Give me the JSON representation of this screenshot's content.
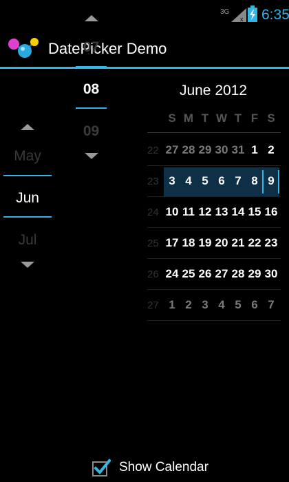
{
  "status_bar": {
    "network": "3G",
    "time": "6:35"
  },
  "action_bar": {
    "title": "DatePicker Demo",
    "logo_icon": "molecule-logo-icon",
    "accent_color": "#33b5e5"
  },
  "spinners": {
    "month": {
      "prev": "May",
      "current": "Jun",
      "next": "Jul"
    },
    "day": {
      "prev": "07",
      "current": "08",
      "next": "09"
    }
  },
  "calendar": {
    "title": "June 2012",
    "weekdays": [
      "S",
      "M",
      "T",
      "W",
      "T",
      "F",
      "S"
    ],
    "selected_date": "8",
    "weeks": [
      {
        "number": "22",
        "days": [
          "27",
          "28",
          "29",
          "30",
          "31",
          "1",
          "2"
        ]
      },
      {
        "number": "23",
        "days": [
          "3",
          "4",
          "5",
          "6",
          "7",
          "8",
          "9"
        ]
      },
      {
        "number": "24",
        "days": [
          "10",
          "11",
          "12",
          "13",
          "14",
          "15",
          "16"
        ]
      },
      {
        "number": "25",
        "days": [
          "17",
          "18",
          "19",
          "20",
          "21",
          "22",
          "23"
        ]
      },
      {
        "number": "26",
        "days": [
          "24",
          "25",
          "26",
          "27",
          "28",
          "29",
          "30"
        ]
      },
      {
        "number": "27",
        "days": [
          "1",
          "2",
          "3",
          "4",
          "5",
          "6",
          "7"
        ]
      }
    ]
  },
  "show_calendar": {
    "label": "Show Calendar",
    "checked": true
  }
}
